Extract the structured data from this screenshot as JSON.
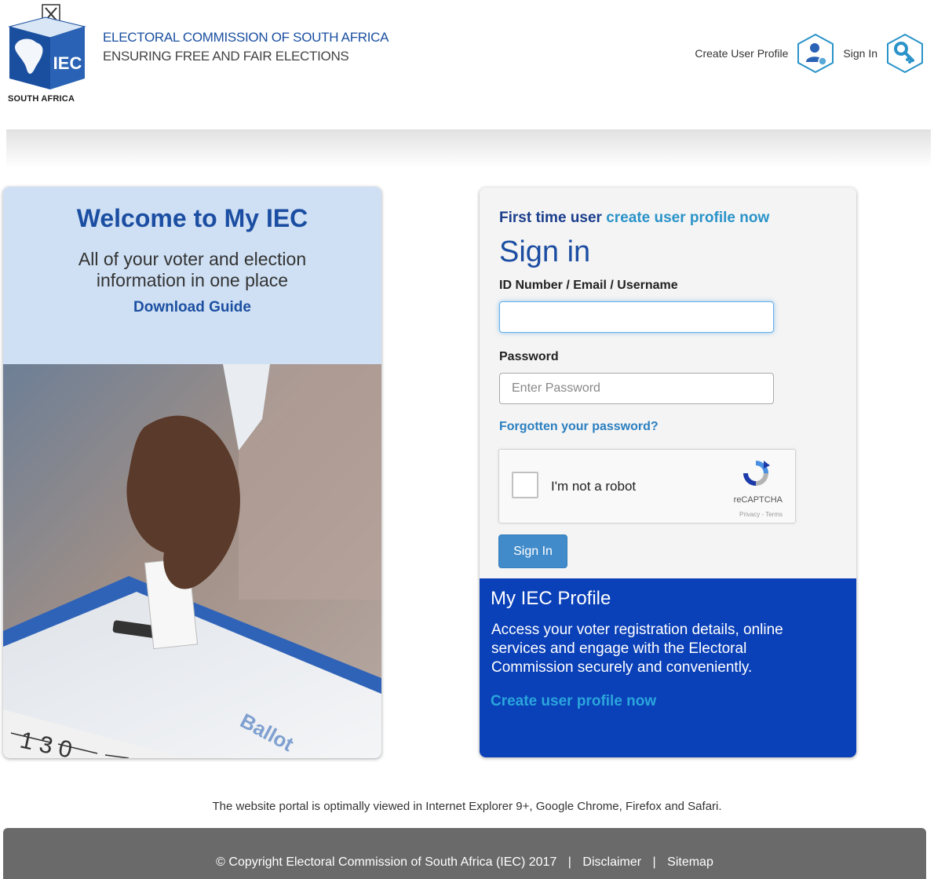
{
  "header": {
    "logo_text": "IEC",
    "logo_caption": "SOUTH AFRICA",
    "org_name": "ELECTORAL COMMISSION OF SOUTH AFRICA",
    "tagline": "ENSURING FREE AND FAIR ELECTIONS",
    "create_profile_label": "Create User Profile",
    "create_profile_icon": "add-user-icon",
    "sign_in_label": "Sign In",
    "sign_in_icon": "key-icon"
  },
  "welcome": {
    "title": "Welcome to My IEC",
    "subtitle": "All of your voter and election information in one place",
    "download_link": "Download Guide"
  },
  "signin": {
    "first_time_text": "First time user",
    "first_time_link": "create user profile now",
    "title": "Sign in",
    "id_label": "ID Number / Email / Username",
    "id_value": "",
    "password_label": "Password",
    "password_placeholder": "Enter Password",
    "forgot_link": "Forgotten your password?",
    "captcha_label": "I'm not a robot",
    "captcha_brand": "reCAPTCHA",
    "captcha_terms": "Privacy - Terms",
    "submit_label": "Sign In"
  },
  "profile": {
    "title": "My IEC Profile",
    "description": "Access your voter registration details, online services and engage with the Electoral Commission securely and conveniently.",
    "link": "Create user profile now"
  },
  "footer": {
    "browser_note": "The website portal is optimally viewed in Internet Explorer 9+, Google Chrome, Firefox and Safari.",
    "copyright": "© Copyright Electoral Commission of South Africa (IEC) 2017",
    "disclaimer": "Disclaimer",
    "sitemap": "Sitemap"
  },
  "colors": {
    "brand_blue": "#1b4ea2",
    "panel_blue": "#0a40b8",
    "button_blue": "#428bca",
    "link_cyan": "#2aa6dc",
    "welcome_bg": "#cfe0f4",
    "footer_gray": "#6a6a6a"
  }
}
